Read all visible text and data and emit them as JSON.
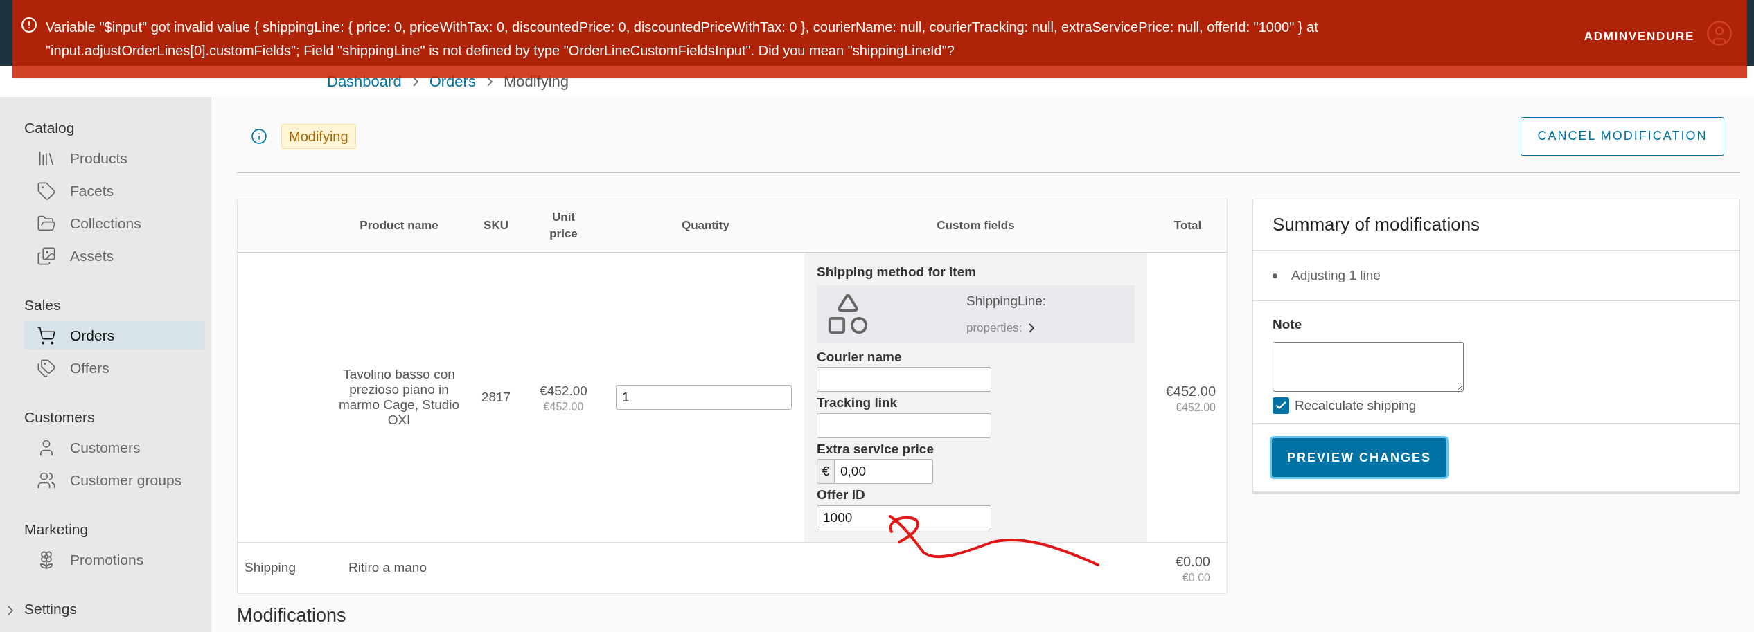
{
  "error_banner": {
    "message": "Variable \"$input\" got invalid value { shippingLine: { price: 0, priceWithTax: 0, discountedPrice: 0, discountedPriceWithTax: 0 }, courierName: null, courierTracking: null, extraServicePrice: null, offerId: \"1000\" } at \"input.adjustOrderLines[0].customFields\"; Field \"shippingLine\" is not defined by type \"OrderLineCustomFieldsInput\". Did you mean \"shippingLineId\"?"
  },
  "header": {
    "user_label": "ADMINVENDURE"
  },
  "breadcrumb": [
    "Dashboard",
    "Orders",
    "Modifying"
  ],
  "sidebar": {
    "sections": [
      {
        "title": "Catalog",
        "items": [
          {
            "label": "Products",
            "selected": false
          },
          {
            "label": "Facets",
            "selected": false
          },
          {
            "label": "Collections",
            "selected": false
          },
          {
            "label": "Assets",
            "selected": false
          }
        ]
      },
      {
        "title": "Sales",
        "items": [
          {
            "label": "Orders",
            "selected": true
          },
          {
            "label": "Offers",
            "selected": false
          }
        ]
      },
      {
        "title": "Customers",
        "items": [
          {
            "label": "Customers",
            "selected": false
          },
          {
            "label": "Customer groups",
            "selected": false
          }
        ]
      },
      {
        "title": "Marketing",
        "items": [
          {
            "label": "Promotions",
            "selected": false
          }
        ]
      },
      {
        "title": "Settings"
      }
    ]
  },
  "page": {
    "state_badge": "Modifying",
    "cancel_button": "CANCEL MODIFICATION"
  },
  "table": {
    "columns": [
      "",
      "Product name",
      "SKU",
      "Unit price",
      "Quantity",
      "Custom fields",
      "Total"
    ],
    "line": {
      "product_name": "Tavolino basso con prezioso piano in marmo Cage, Studio OXI",
      "sku": "2817",
      "unit_price": "€452.00",
      "unit_price_with_tax": "€452.00",
      "quantity": "1",
      "total": "€452.00",
      "total_with_tax": "€452.00",
      "custom_fields": {
        "shipping_label": "Shipping method for item",
        "relation_title": "ShippingLine:",
        "relation_link": "properties:",
        "courier_label": "Courier name",
        "tracking_label": "Tracking link",
        "extra_label": "Extra service price",
        "currency": "€",
        "extra_value": "0,00",
        "offer_label": "Offer ID",
        "offer_value": "1000"
      }
    },
    "shipping": {
      "label": "Shipping",
      "method": "Ritiro a mano",
      "total": "€0.00",
      "total_with_tax": "€0.00"
    }
  },
  "summary": {
    "title": "Summary of modifications",
    "items": [
      "Adjusting 1 line"
    ],
    "note_label": "Note",
    "recalculate": {
      "label": "Recalculate shipping",
      "checked": true
    },
    "preview_button": "PREVIEW CHANGES"
  },
  "modifications_heading": "Modifications"
}
